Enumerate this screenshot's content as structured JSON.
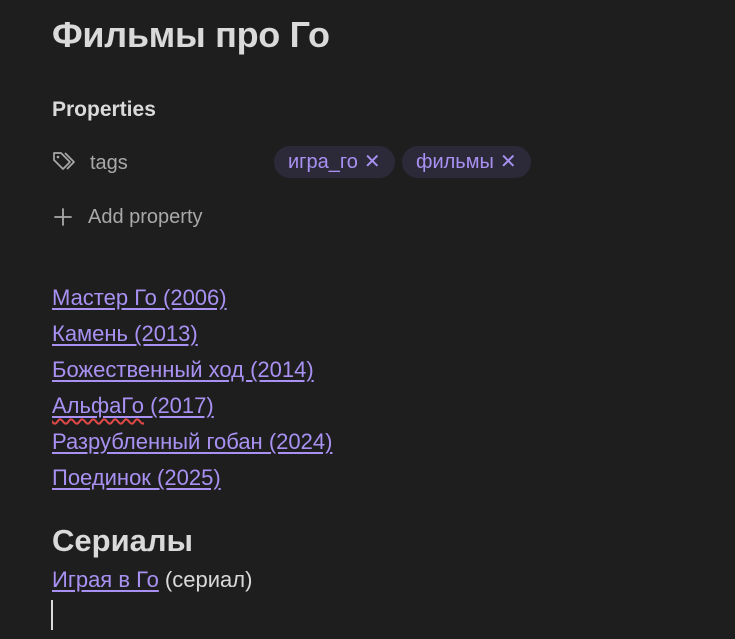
{
  "note": {
    "title": "Фильмы про Го"
  },
  "properties": {
    "heading": "Properties",
    "tags_key": "tags",
    "tags": [
      {
        "label": "игра_го",
        "remove": "✕"
      },
      {
        "label": "фильмы",
        "remove": "✕"
      }
    ],
    "add_property_label": "Add property",
    "icon": "tag-icon",
    "add_icon": "plus-icon"
  },
  "films": [
    {
      "label": "Мастер Го (2006)"
    },
    {
      "label": "Камень (2013)"
    },
    {
      "label": "Божественный ход (2014)"
    },
    {
      "label_misspelled": "АльфаГо",
      "label_rest": " (2017)"
    },
    {
      "label": "Разрубленный гобан (2024)"
    },
    {
      "label": "Поединок (2025)"
    }
  ],
  "series_section": {
    "heading": "Сериалы",
    "link_label": "Играя в Го",
    "note": " (сериал)"
  },
  "colors": {
    "background": "#1e1e1e",
    "text": "#dadada",
    "muted": "#a9a9a9",
    "accent": "#a891f2",
    "tag_bg": "#2c2a38",
    "spellcheck": "#e04848"
  }
}
